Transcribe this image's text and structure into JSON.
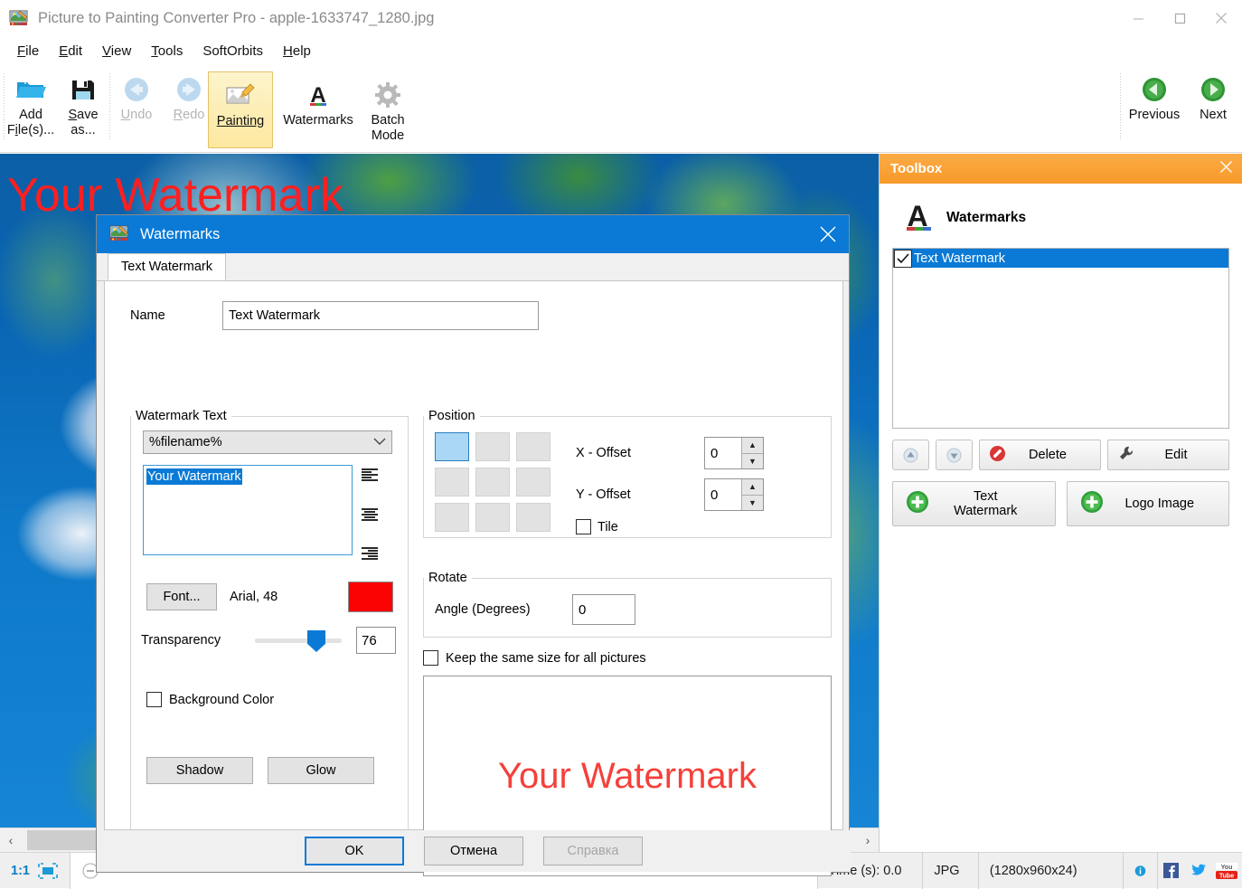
{
  "window": {
    "title": "Picture to Painting Converter Pro - apple-1633747_1280.jpg",
    "icon": "app-icon",
    "minimize": "—",
    "maximize": "▢",
    "close": "✕"
  },
  "menu": {
    "items": [
      {
        "label": "File",
        "accel": "F"
      },
      {
        "label": "Edit",
        "accel": "E"
      },
      {
        "label": "View",
        "accel": "V"
      },
      {
        "label": "Tools",
        "accel": "T"
      },
      {
        "label": "SoftOrbits",
        "accel": ""
      },
      {
        "label": "Help",
        "accel": "H"
      }
    ]
  },
  "toolbar": {
    "buttons": [
      {
        "label_line1": "Add",
        "label_line2": "File(s)...",
        "icon": "open-folder-icon",
        "state": "enabled"
      },
      {
        "label_line1": "Save",
        "label_line2": "as...",
        "icon": "floppy-disk-icon",
        "state": "enabled"
      },
      {
        "label_line1": "Undo",
        "label_line2": "",
        "icon": "arrow-left-circle-icon",
        "state": "disabled"
      },
      {
        "label_line1": "Redo",
        "label_line2": "",
        "icon": "arrow-right-circle-icon",
        "state": "disabled"
      },
      {
        "label_line1": "Painting",
        "label_line2": "",
        "icon": "picture-pencil-icon",
        "state": "active"
      },
      {
        "label_line1": "Watermarks",
        "label_line2": "",
        "icon": "letter-a-icon",
        "state": "enabled"
      },
      {
        "label_line1": "Batch",
        "label_line2": "Mode",
        "icon": "gear-icon",
        "state": "enabled"
      },
      {
        "label_line1": "Previous",
        "label_line2": "",
        "icon": "green-left-circle-icon",
        "state": "enabled"
      },
      {
        "label_line1": "Next",
        "label_line2": "",
        "icon": "green-right-circle-icon",
        "state": "enabled"
      }
    ],
    "overflow": "▾"
  },
  "canvas": {
    "watermark_text": "Your Watermark",
    "watermark_color": "#ff1f1f",
    "scroll_left_arrow": "‹",
    "scroll_right_arrow": "›"
  },
  "statusbar": {
    "zoom": "1:1",
    "fit_icon": "fit-to-window-icon",
    "time": "Time (s): 0.0",
    "format": "JPG",
    "dimensions": "(1280x960x24)",
    "info_icon": "info-icon",
    "facebook_icon": "facebook-icon",
    "twitter_icon": "twitter-icon",
    "youtube_icon": "youtube-icon"
  },
  "toolbox": {
    "title": "Toolbox",
    "close": "✕",
    "section_title": "Watermarks",
    "section_icon": "letter-a-icon",
    "list": [
      {
        "label": "Text Watermark",
        "checked": true,
        "selected": true
      }
    ],
    "move_up": "▲",
    "move_down": "▼",
    "delete_label": "Delete",
    "edit_label": "Edit",
    "add_text_label": "Text Watermark",
    "add_logo_label": "Logo Image",
    "header_color": "#f79a2a",
    "selection_color": "#0a7ad6"
  },
  "dialog": {
    "title": "Watermarks",
    "close": "✕",
    "tab": "Text Watermark",
    "name_label": "Name",
    "name_value": "Text Watermark",
    "watermark_text_group": {
      "legend": "Watermark Text",
      "select_value": "%filename%",
      "select_caret": "⌄",
      "textarea_value": "Your Watermark",
      "align_options": [
        "align-left",
        "align-center",
        "align-right"
      ],
      "font_button": "Font...",
      "font_desc": "Arial, 48",
      "color": "#fb0303",
      "transparency_label": "Transparency",
      "transparency_value": "76",
      "background_color_label": "Background Color",
      "background_color_checked": false,
      "shadow_button": "Shadow",
      "glow_button": "Glow"
    },
    "position_group": {
      "legend": "Position",
      "selected_cell": 0,
      "x_offset_label": "X - Offset",
      "x_offset_value": "0",
      "y_offset_label": "Y - Offset",
      "y_offset_value": "0",
      "tile_label": "Tile",
      "tile_checked": false,
      "spin_up": "▲",
      "spin_down": "▼"
    },
    "rotate_group": {
      "legend": "Rotate",
      "angle_label": "Angle (Degrees)",
      "angle_value": "0"
    },
    "keep_size_label": "Keep the same size for all pictures",
    "keep_size_checked": false,
    "preview_text": "Your Watermark",
    "preview_color": "#f5403a",
    "buttons": {
      "ok": "OK",
      "cancel": "Отмена",
      "help": "Справка"
    }
  }
}
